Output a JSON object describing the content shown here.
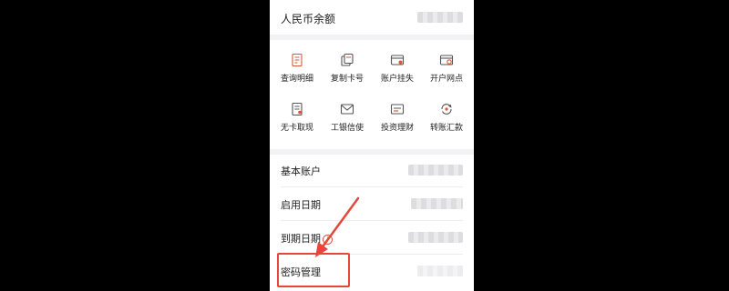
{
  "balance": {
    "label": "人民币余额"
  },
  "quick_actions": [
    {
      "label": "查询明细",
      "icon": "query-detail-icon"
    },
    {
      "label": "复制卡号",
      "icon": "copy-card-number-icon"
    },
    {
      "label": "账户挂失",
      "icon": "report-loss-icon"
    },
    {
      "label": "开户网点",
      "icon": "branch-icon"
    },
    {
      "label": "无卡取现",
      "icon": "cardless-withdraw-icon"
    },
    {
      "label": "工银信使",
      "icon": "envelope-icon"
    },
    {
      "label": "投资理财",
      "icon": "investment-icon"
    },
    {
      "label": "转账汇款",
      "icon": "transfer-icon"
    }
  ],
  "info_rows": [
    {
      "label": "基本账户"
    },
    {
      "label": "启用日期"
    },
    {
      "label": "到期日期",
      "info_icon": "i"
    },
    {
      "label": "密码管理"
    }
  ],
  "colors": {
    "icon": "#e0553a",
    "annotation": "#e8463a"
  }
}
